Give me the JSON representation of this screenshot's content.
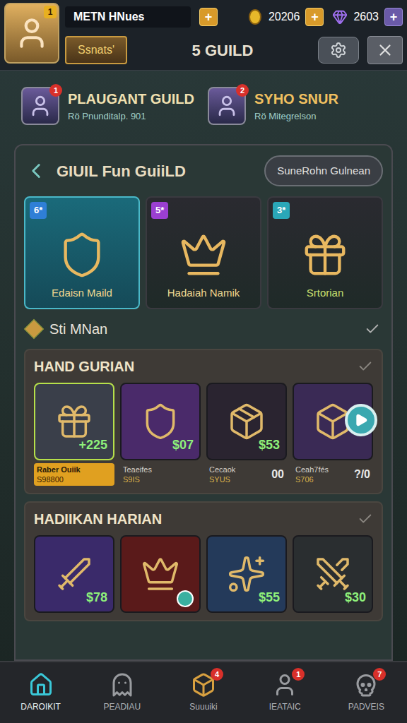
{
  "player": {
    "name": "METN HNues",
    "coins": "20206",
    "gems": "2603",
    "level": "1",
    "plus": "+"
  },
  "header": {
    "button": "Ssnats'",
    "title": "5 GUILD"
  },
  "guilds": [
    {
      "name": "PLAUGANT GUILD",
      "sub": "Rö Pnunditalp. 901",
      "badge": "1"
    },
    {
      "name": "SYHO SNUR",
      "sub": "Rö Mitegrelson",
      "badge": "2"
    }
  ],
  "panel": {
    "title": "GIUIL Fun GuiiLD",
    "button": "SuneRohn Gulnean"
  },
  "featured": [
    {
      "stars": "6*",
      "name": "Edaisn Maild",
      "selected": true,
      "color": "#2f7fd6"
    },
    {
      "stars": "5*",
      "name": "Hadaiah Namik",
      "selected": false,
      "color": "#9b3fd0"
    },
    {
      "stars": "3*",
      "name": "Srtorian",
      "selected": false,
      "color": "#2aa7b8"
    }
  ],
  "subheader": {
    "title": "Sti MNan"
  },
  "sections": [
    {
      "title": "HAND GURIAN",
      "items": [
        {
          "price": "+225",
          "name": "Raber Ouiik",
          "sub": "S98800",
          "selected": true,
          "color": "#3a3f4a"
        },
        {
          "price": "$07",
          "name": "Teaeifes",
          "sub": "S9IS",
          "selected": false,
          "color": "#4a2a6a"
        },
        {
          "price": "$53",
          "name": "Cecaok",
          "sub": "SYUS",
          "extra": "00",
          "selected": false,
          "color": "#2a2430"
        },
        {
          "name": "Ceah7fés",
          "sub": "S706",
          "extra": "?/0",
          "selected": false,
          "color": "#3a2a55"
        }
      ]
    },
    {
      "title": "HADIIKAN HARIAN",
      "items": [
        {
          "price": "$78",
          "selected": false,
          "color": "#3a2a6a",
          "has_action": false
        },
        {
          "selected": false,
          "color": "#5a1a1a",
          "has_action": true
        },
        {
          "price": "$55",
          "selected": false,
          "color": "#243a5a",
          "has_action": false
        },
        {
          "price": "$30",
          "selected": false,
          "color": "#2a2e30",
          "has_action": false
        }
      ]
    }
  ],
  "nav": [
    {
      "label": "DAROIKIT",
      "selected": true
    },
    {
      "label": "PEADIAU",
      "selected": false
    },
    {
      "label": "Suuuiki",
      "selected": false,
      "badge": "4"
    },
    {
      "label": "IEATAIC",
      "selected": false,
      "badge": "1"
    },
    {
      "label": "PADVEIS",
      "selected": false,
      "badge": "7"
    }
  ]
}
